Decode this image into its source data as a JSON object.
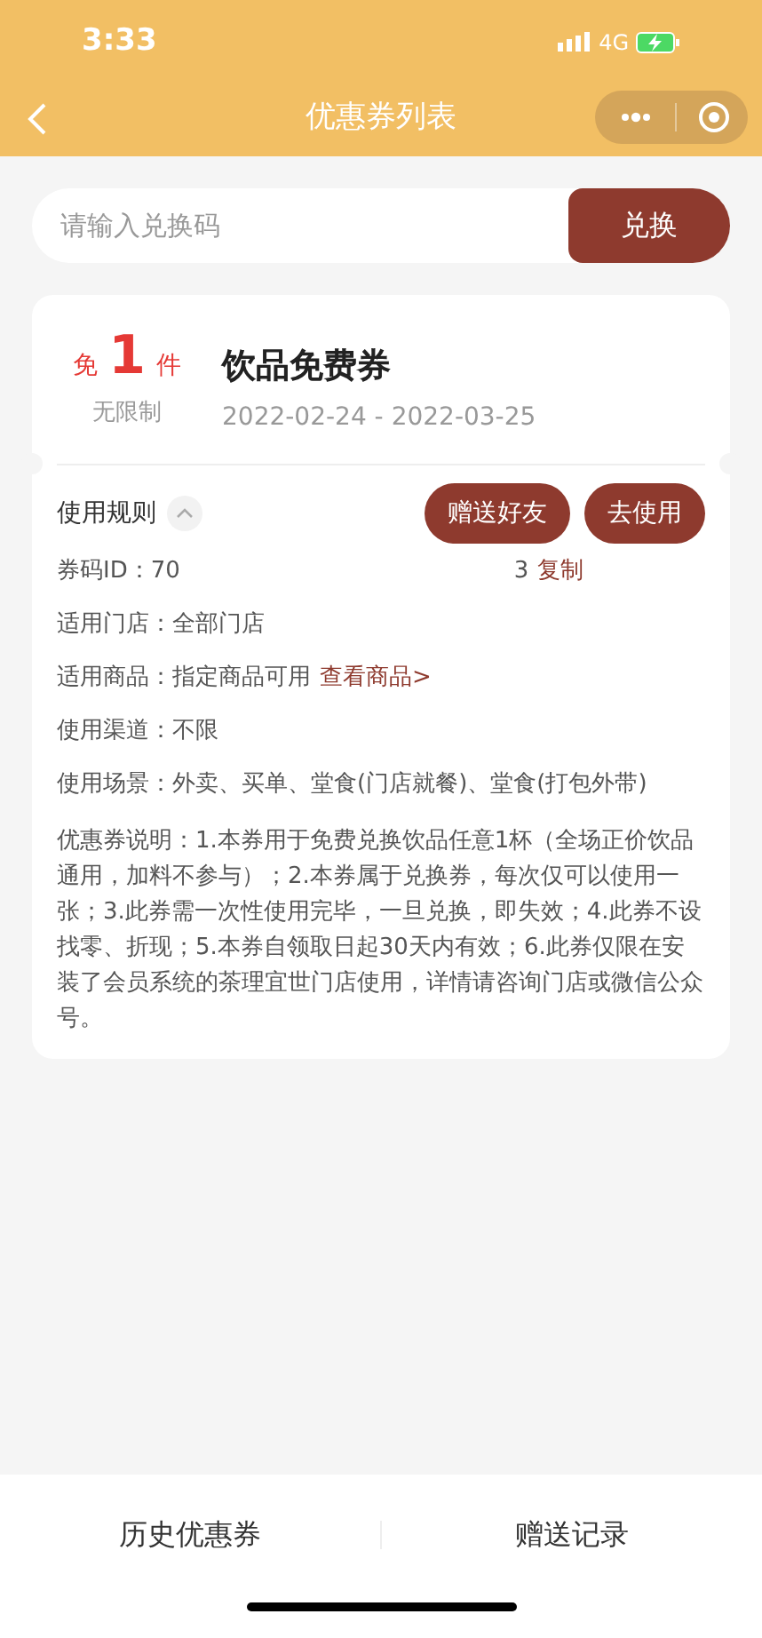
{
  "status_bar": {
    "time": "3:33",
    "network": "4G"
  },
  "nav": {
    "title": "优惠券列表"
  },
  "redeem": {
    "placeholder": "请输入兑换码",
    "button": "兑换"
  },
  "coupon": {
    "prefix": "免",
    "amount": "1",
    "unit": "件",
    "limit": "无限制",
    "title": "饮品免费券",
    "validity": "2022-02-24 - 2022-03-25",
    "rules_label": "使用规则",
    "rules_expanded": true,
    "actions": [
      {
        "label": "赠送好友"
      },
      {
        "label": "去使用"
      }
    ],
    "code": {
      "label": "券码ID：",
      "start": "70",
      "end": "3",
      "link": "复制"
    },
    "details": [
      {
        "label": "适用门店：",
        "value": "全部门店"
      },
      {
        "label": "适用商品：",
        "value": "指定商品可用",
        "link": "查看商品>"
      },
      {
        "label": "使用渠道：",
        "value": "不限"
      },
      {
        "label": "使用场景：",
        "value": "外卖、买单、堂食(门店就餐)、堂食(打包外带)"
      }
    ],
    "description": "优惠券说明：1.本券用于免费兑换饮品任意1杯（全场正价饮品通用，加料不参与）；2.本券属于兑换券，每次仅可以使用一张；3.此券需一次性使用完毕，一旦兑换，即失效；4.此券不设找零、折现；5.本券自领取日起30天内有效；6.此券仅限在安装了会员系统的茶理宜世门店使用，详情请咨询门店或微信公众号。"
  },
  "bottom_tabs": [
    {
      "label": "历史优惠券"
    },
    {
      "label": "赠送记录"
    }
  ]
}
